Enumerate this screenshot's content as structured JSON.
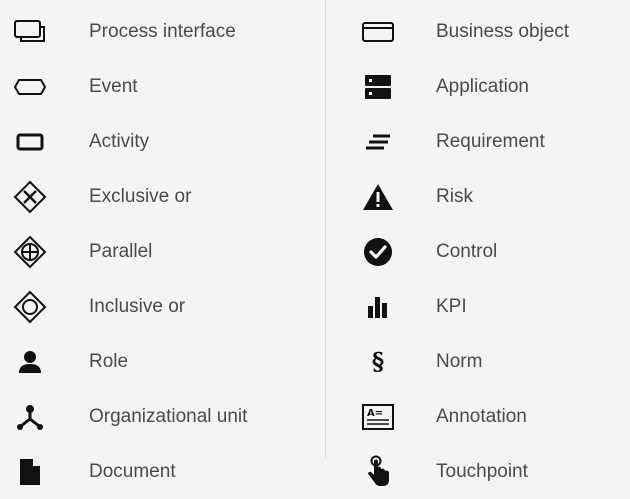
{
  "left_items": [
    {
      "label": "Process interface",
      "icon": "process-interface-icon"
    },
    {
      "label": "Event",
      "icon": "event-icon"
    },
    {
      "label": "Activity",
      "icon": "activity-icon"
    },
    {
      "label": "Exclusive or",
      "icon": "exclusive-or-icon"
    },
    {
      "label": "Parallel",
      "icon": "parallel-icon"
    },
    {
      "label": "Inclusive or",
      "icon": "inclusive-or-icon"
    },
    {
      "label": "Role",
      "icon": "role-icon"
    },
    {
      "label": "Organizational unit",
      "icon": "organizational-unit-icon"
    },
    {
      "label": "Document",
      "icon": "document-icon"
    }
  ],
  "right_items": [
    {
      "label": "Business object",
      "icon": "business-object-icon"
    },
    {
      "label": "Application",
      "icon": "application-icon"
    },
    {
      "label": "Requirement",
      "icon": "requirement-icon"
    },
    {
      "label": "Risk",
      "icon": "risk-icon"
    },
    {
      "label": "Control",
      "icon": "control-icon"
    },
    {
      "label": "KPI",
      "icon": "kpi-icon"
    },
    {
      "label": "Norm",
      "icon": "norm-icon",
      "glyph": "§"
    },
    {
      "label": "Annotation",
      "icon": "annotation-icon",
      "glyph": "A="
    },
    {
      "label": "Touchpoint",
      "icon": "touchpoint-icon"
    }
  ],
  "colors": {
    "background": "#f4f4f4",
    "icon": "#111111",
    "label": "#4a4a4a",
    "divider": "#dcdcdc"
  }
}
